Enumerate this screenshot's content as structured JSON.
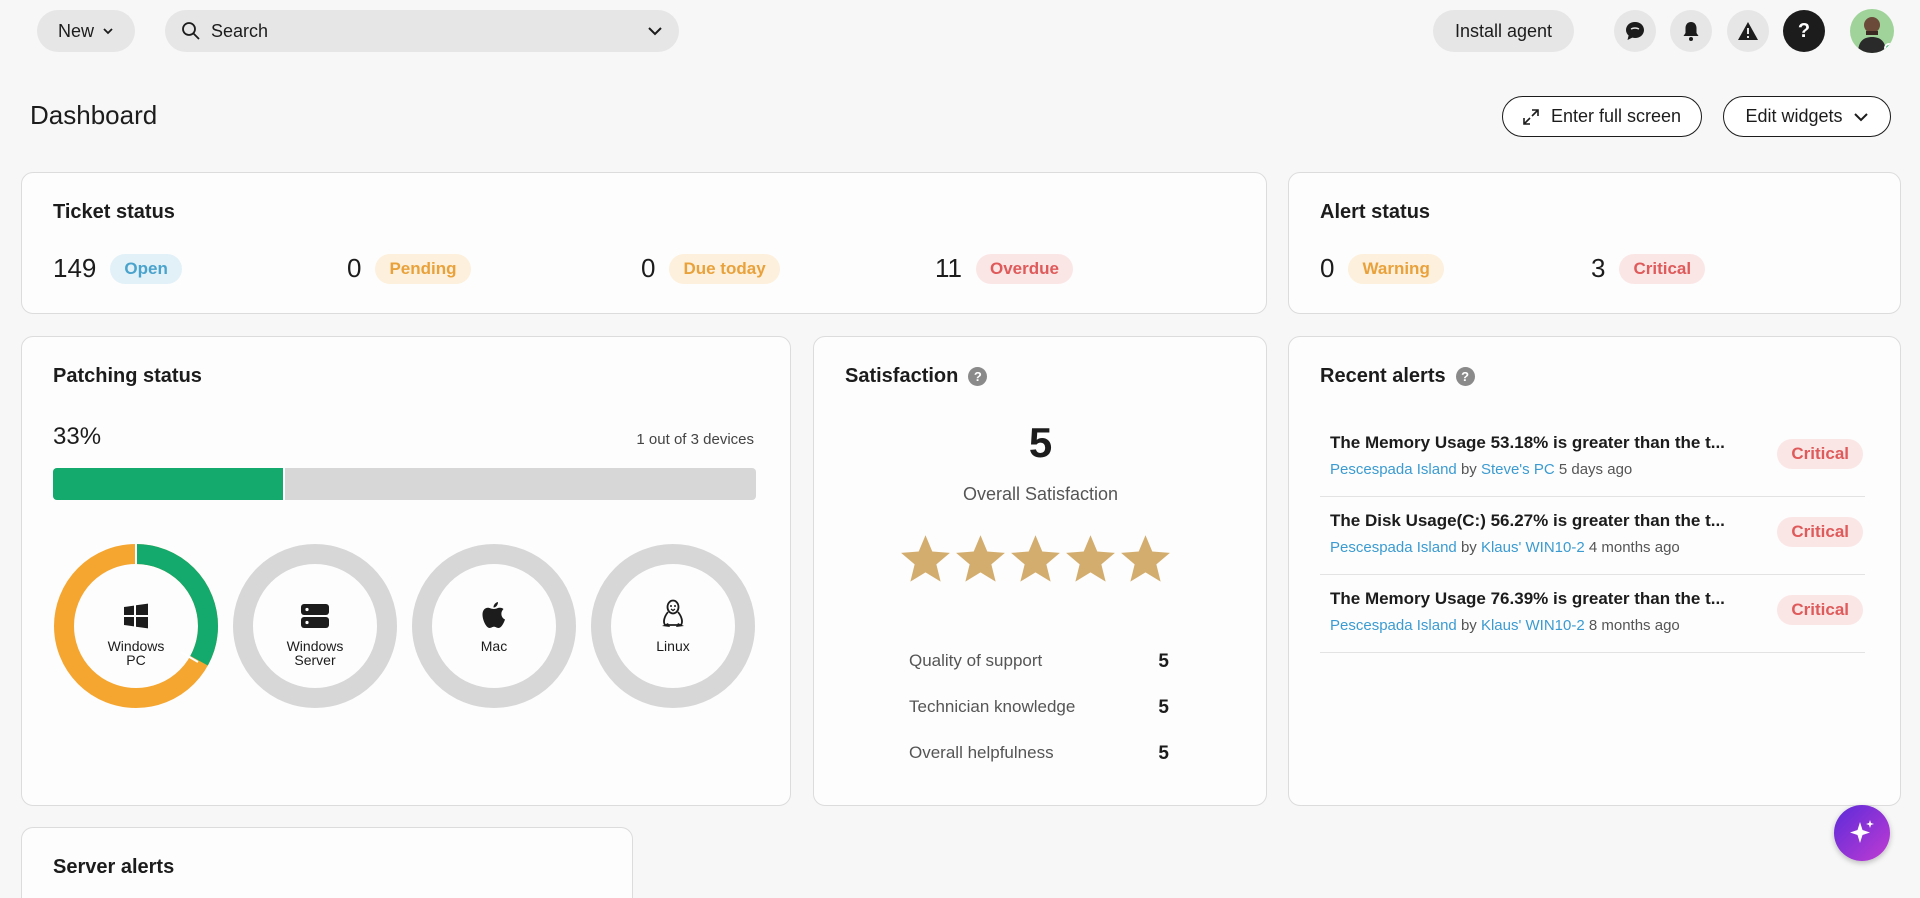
{
  "topbar": {
    "new_label": "New",
    "search_placeholder": "Search",
    "install_label": "Install agent"
  },
  "page": {
    "title": "Dashboard",
    "fullscreen_label": "Enter full screen",
    "edit_widgets_label": "Edit widgets"
  },
  "ticket_status": {
    "title": "Ticket status",
    "items": [
      {
        "count": "149",
        "label": "Open",
        "color": "blue"
      },
      {
        "count": "0",
        "label": "Pending",
        "color": "orange"
      },
      {
        "count": "0",
        "label": "Due today",
        "color": "orange"
      },
      {
        "count": "11",
        "label": "Overdue",
        "color": "red"
      }
    ]
  },
  "alert_status": {
    "title": "Alert status",
    "items": [
      {
        "count": "0",
        "label": "Warning",
        "color": "orange"
      },
      {
        "count": "3",
        "label": "Critical",
        "color": "red"
      }
    ]
  },
  "patching": {
    "title": "Patching status",
    "percent_text": "33%",
    "percent": 33,
    "devices_text": "1 out of 3 devices",
    "donuts": [
      {
        "label_line1": "Windows",
        "label_line2": "PC",
        "icon": "windows-icon",
        "patched_fraction": 0.33
      },
      {
        "label_line1": "Windows",
        "label_line2": "Server",
        "icon": "server-icon",
        "patched_fraction": 0
      },
      {
        "label_line1": "Mac",
        "label_line2": "",
        "icon": "apple-icon",
        "patched_fraction": 0
      },
      {
        "label_line1": "Linux",
        "label_line2": "",
        "icon": "linux-icon",
        "patched_fraction": 0
      }
    ]
  },
  "satisfaction": {
    "title": "Satisfaction",
    "help": "?",
    "score": "5",
    "subtitle": "Overall Satisfaction",
    "stars": 5,
    "rows": [
      {
        "label": "Quality of support",
        "value": "5"
      },
      {
        "label": "Technician knowledge",
        "value": "5"
      },
      {
        "label": "Overall helpfulness",
        "value": "5"
      }
    ]
  },
  "recent_alerts": {
    "title": "Recent alerts",
    "help": "?",
    "items": [
      {
        "title": "The Memory Usage 53.18% is greater than the t...",
        "site": "Pescespada Island",
        "by": "by",
        "device": "Steve's PC",
        "time": "5 days ago",
        "severity": "Critical"
      },
      {
        "title": "The Disk Usage(C:) 56.27% is greater than the t...",
        "site": "Pescespada Island",
        "by": "by",
        "device": "Klaus' WIN10-2",
        "time": "4 months ago",
        "severity": "Critical"
      },
      {
        "title": "The Memory Usage 76.39% is greater than the t...",
        "site": "Pescespada Island",
        "by": "by",
        "device": "Klaus' WIN10-2",
        "time": "8 months ago",
        "severity": "Critical"
      }
    ]
  },
  "server_alerts": {
    "title": "Server alerts"
  },
  "colors": {
    "green": "#14a96d",
    "orange": "#f5a630",
    "grey": "#d7d7d7",
    "star": "#d3ad6e"
  }
}
